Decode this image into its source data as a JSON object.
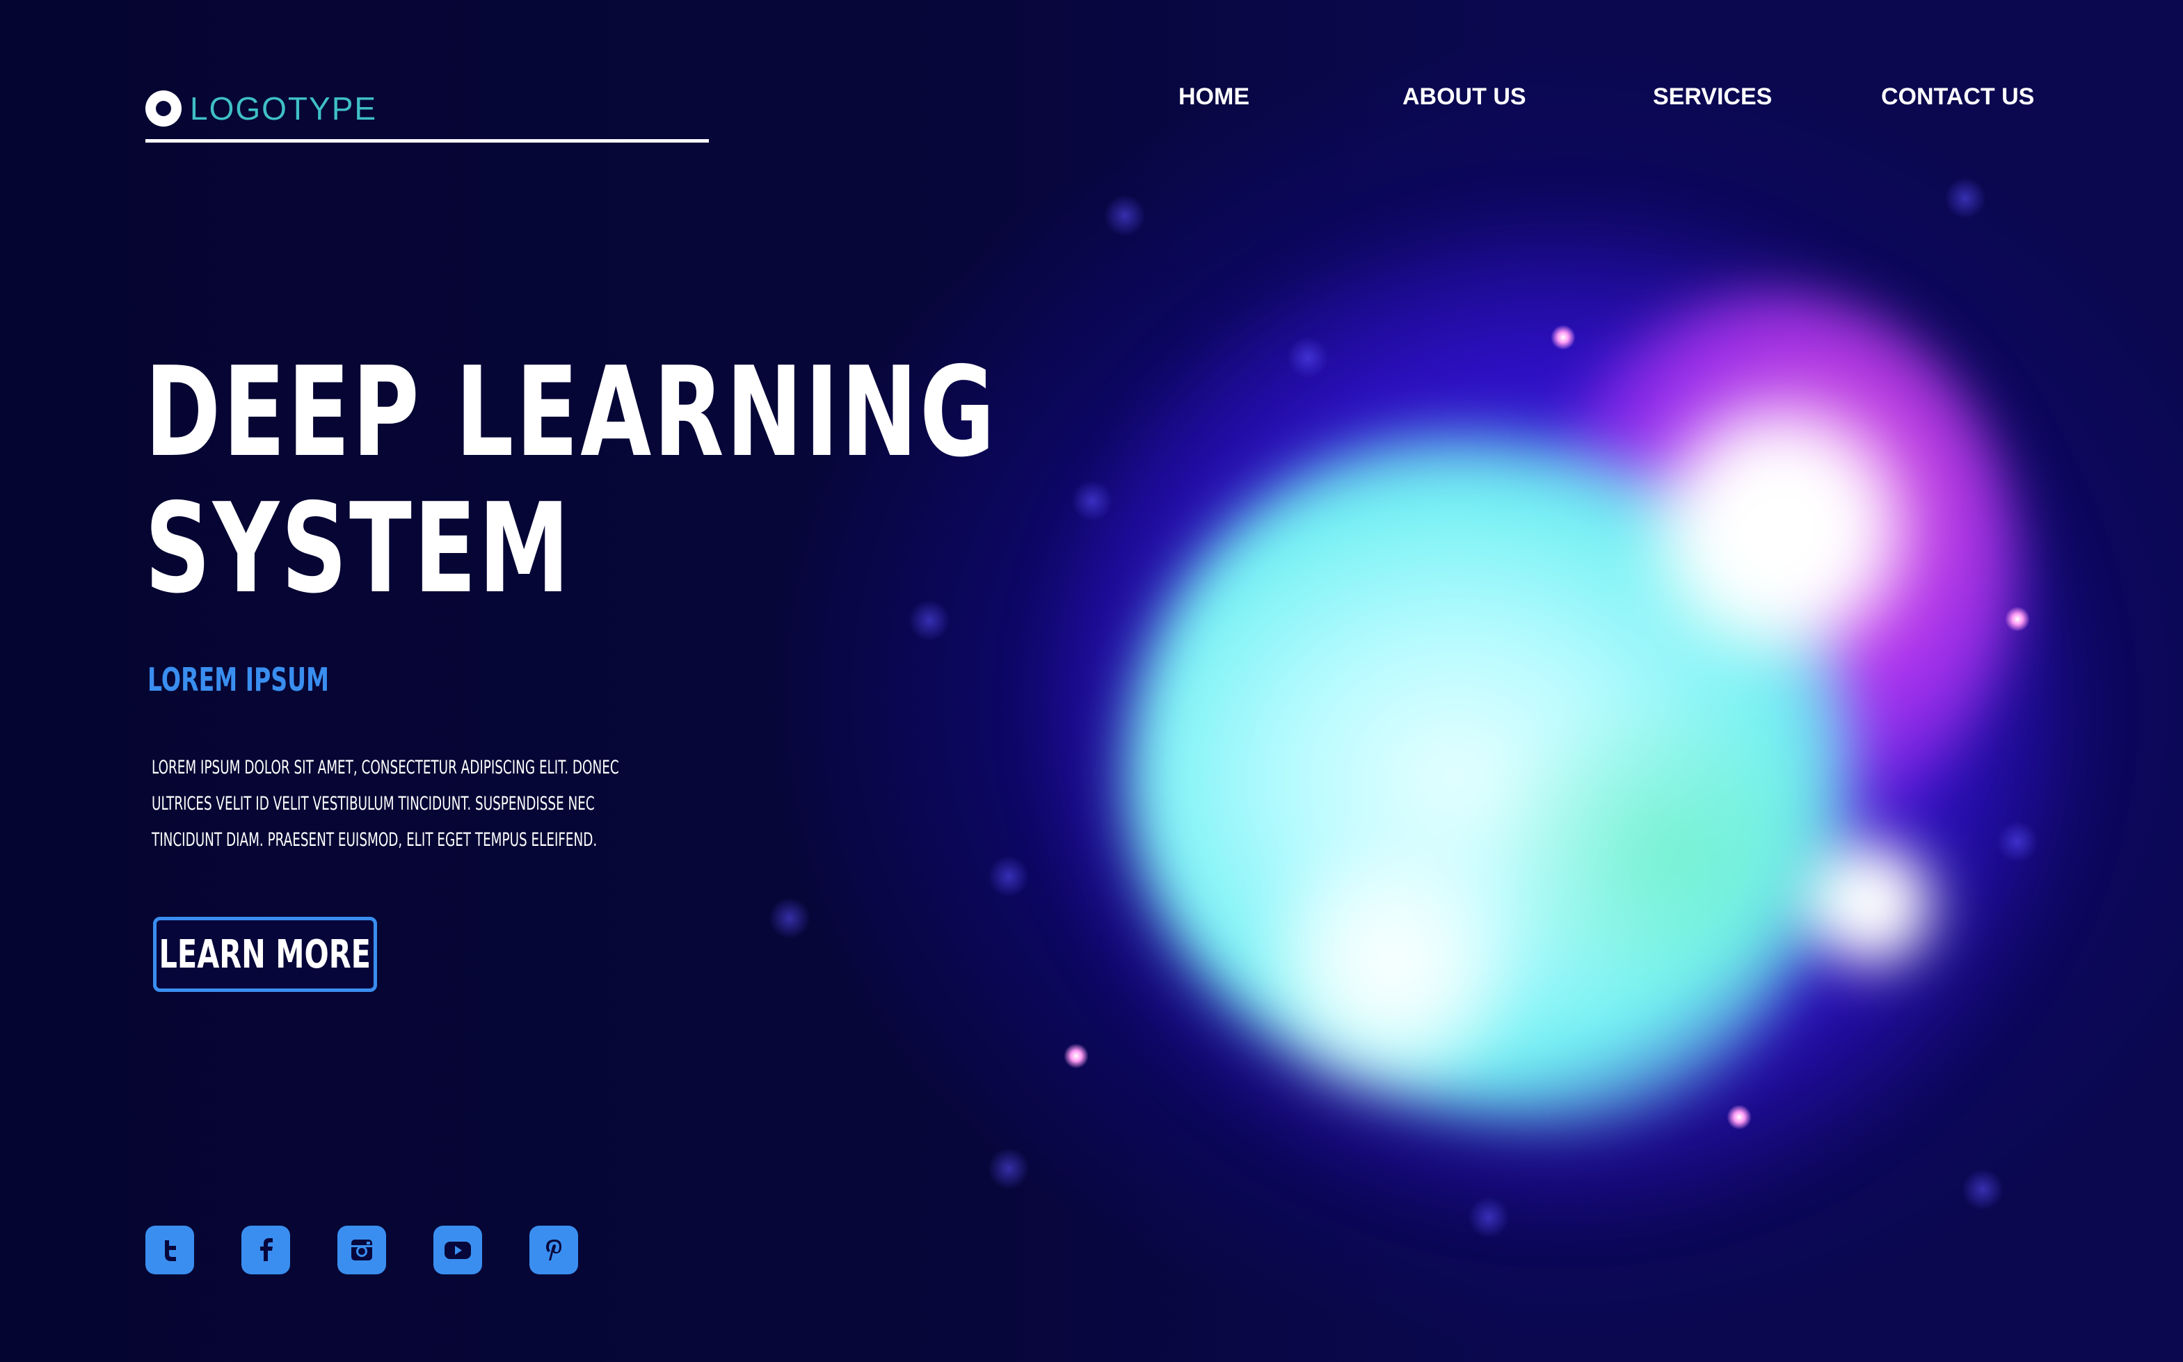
{
  "header": {
    "logo_text": "LOGOTYPE",
    "nav": [
      {
        "label": "HOME"
      },
      {
        "label": "ABOUT US"
      },
      {
        "label": "SERVICES"
      },
      {
        "label": "CONTACT US"
      }
    ]
  },
  "hero": {
    "title_line1": "DEEP LEARNING",
    "title_line2": "SYSTEM",
    "subtitle": "LOREM IPSUM",
    "body_lines": [
      "LOREM IPSUM DOLOR SIT AMET, CONSECTETUR ADIPISCING ELIT. DONEC",
      "ULTRICES VELIT ID VELIT VESTIBULUM TINCIDUNT. SUSPENDISSE NEC",
      "TINCIDUNT DIAM. PRAESENT EUISMOD, ELIT EGET TEMPUS ELEIFEND."
    ],
    "button_label": "LEARN MORE"
  },
  "social": [
    {
      "icon": "twitter-icon"
    },
    {
      "icon": "facebook-icon"
    },
    {
      "icon": "instagram-icon"
    },
    {
      "icon": "youtube-icon"
    },
    {
      "icon": "pinterest-icon"
    }
  ],
  "colors": {
    "background": "#07063a",
    "accent": "#3a8ef0",
    "logo": "#3fc0c6",
    "text": "#ffffff"
  }
}
